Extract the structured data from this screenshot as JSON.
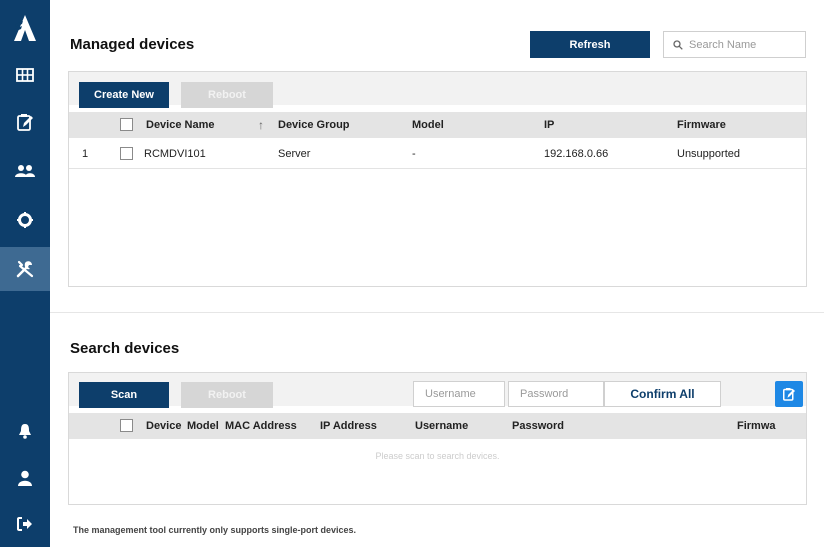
{
  "sidebar": {
    "items": [
      {
        "icon": "logo-icon"
      },
      {
        "icon": "grid-icon"
      },
      {
        "icon": "clipboard-edit-icon"
      },
      {
        "icon": "users-icon"
      },
      {
        "icon": "gear-icon"
      },
      {
        "icon": "tools-icon",
        "active": true
      },
      {
        "icon": "bell-icon"
      },
      {
        "icon": "user-icon"
      },
      {
        "icon": "logout-icon"
      }
    ]
  },
  "managed": {
    "title": "Managed devices",
    "refresh_label": "Refresh",
    "search_placeholder": "Search Name",
    "create_label": "Create New",
    "reboot_label": "Reboot",
    "columns": [
      "Device Name",
      "Device Group",
      "Model",
      "IP",
      "Firmware"
    ],
    "sort_indicator": "↑",
    "rows": [
      {
        "index": "1",
        "name": "RCMDVI101",
        "group": "Server",
        "model": "-",
        "ip": "192.168.0.66",
        "firmware": "Unsupported"
      }
    ]
  },
  "search": {
    "title": "Search devices",
    "scan_label": "Scan",
    "reboot_label": "Reboot",
    "username_placeholder": "Username",
    "password_placeholder": "Password",
    "confirm_label": "Confirm All",
    "columns": [
      "Device",
      "Model",
      "MAC Address",
      "IP Address",
      "Username",
      "Password",
      "Firmwa"
    ],
    "empty_message": "Please scan to search devices."
  },
  "footnote": "The management tool currently only supports single-port devices.",
  "colors": {
    "sidebar": "#0d3e6b",
    "primary": "#0d3e6b",
    "accent": "#1e88e5",
    "disabled": "#d6d6d6"
  }
}
